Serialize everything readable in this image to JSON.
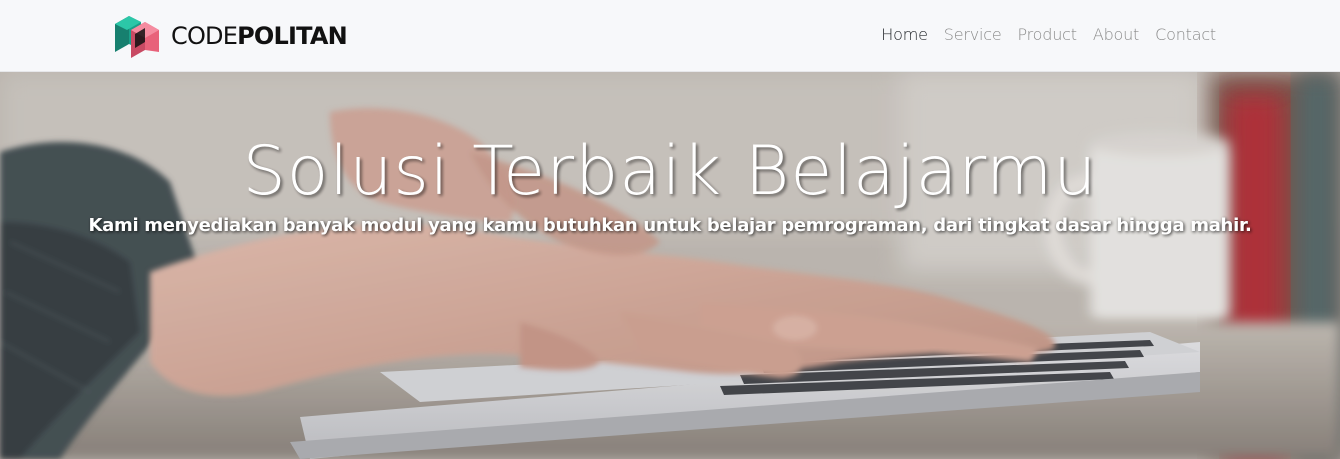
{
  "brand": {
    "name_light": "CODE",
    "name_bold": "POLITAN",
    "logo_icon": "codepolitan-logo-icon",
    "colors": {
      "teal": "#1aa08a",
      "pink": "#e8627a",
      "dark": "#111111"
    }
  },
  "nav": {
    "items": [
      {
        "label": "Home",
        "active": true
      },
      {
        "label": "Service",
        "active": false
      },
      {
        "label": "Product",
        "active": false
      },
      {
        "label": "About",
        "active": false
      },
      {
        "label": "Contact",
        "active": false
      }
    ]
  },
  "hero": {
    "title": "Solusi Terbaik Belajarmu",
    "subtitle": "Kami menyediakan banyak modul yang kamu butuhkan untuk belajar pemrograman, dari tingkat dasar hingga mahir.",
    "background": "hands-typing-on-laptop-photo"
  }
}
